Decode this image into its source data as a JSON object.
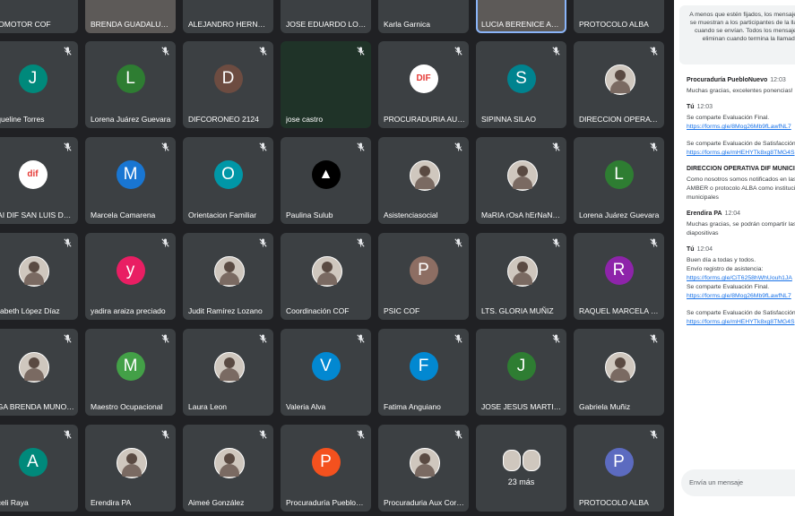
{
  "participants": [
    [
      {
        "name": "ROMOTOR COF",
        "letter": "",
        "color": "#1e88e5",
        "muted": false
      },
      {
        "name": "BRENDA GUADALUPE ...",
        "letter": "",
        "color": "#5d5a58",
        "muted": false,
        "photo": true
      },
      {
        "name": "ALEJANDRO HERNAND...",
        "letter": "",
        "color": "#e91e63",
        "muted": false
      },
      {
        "name": "JOSE EDUARDO LOPEZ...",
        "letter": "",
        "color": "#ff5722",
        "muted": false
      },
      {
        "name": "Karla Garnica",
        "letter": "",
        "color": "#3c4043",
        "muted": false
      },
      {
        "name": "LUCIA BERENICE ACOS...",
        "letter": "",
        "color": "#5d5a58",
        "muted": false,
        "photo": true,
        "highlight": true
      },
      {
        "name": "PROTOCOLO ALBA",
        "letter": "",
        "color": "#7b1fa2",
        "muted": false
      }
    ],
    [
      {
        "name": "cqueline Torres",
        "letter": "J",
        "color": "#00897b",
        "muted": true
      },
      {
        "name": "Lorena Juárez Guevara",
        "letter": "L",
        "color": "#2e7d32",
        "muted": true
      },
      {
        "name": "DIFCORONEO 2124",
        "letter": "D",
        "color": "#6d4c41",
        "muted": true
      },
      {
        "name": "jose castro",
        "letter": "",
        "color": "",
        "muted": true,
        "dark": true
      },
      {
        "name": "PROCURADURIA AUXIL...",
        "letter": "DIF",
        "color": "#fff",
        "muted": true,
        "logo": true
      },
      {
        "name": "SIPINNA SILAO",
        "letter": "S",
        "color": "#00838f",
        "muted": true
      },
      {
        "name": "DIRECCION OPERATIV...",
        "letter": "",
        "color": "",
        "muted": true,
        "img": true
      }
    ],
    [
      {
        "name": "PAI DIF SAN LUIS DE L...",
        "letter": "dif",
        "color": "#fff",
        "muted": true,
        "logo": true
      },
      {
        "name": "Marcela Camarena",
        "letter": "M",
        "color": "#1976d2",
        "muted": true
      },
      {
        "name": "Orientacion Familiar",
        "letter": "O",
        "color": "#0097a7",
        "muted": true
      },
      {
        "name": "Paulina Sulub",
        "letter": "▲",
        "color": "#000",
        "muted": true
      },
      {
        "name": "Asistenciasocial",
        "letter": "",
        "color": "",
        "muted": true,
        "img": true
      },
      {
        "name": "MaRIA rOsA hErNaNdE...",
        "letter": "",
        "color": "",
        "muted": true,
        "img": true
      },
      {
        "name": "Lorena Juárez Guevara",
        "letter": "L",
        "color": "#2e7d32",
        "muted": true
      }
    ],
    [
      {
        "name": "lizabeth López Díaz",
        "letter": "",
        "color": "",
        "muted": true,
        "img": true
      },
      {
        "name": "yadira araiza preciado",
        "letter": "y",
        "color": "#e91e63",
        "muted": true
      },
      {
        "name": "Judit Ramírez Lozano",
        "letter": "",
        "color": "",
        "muted": true,
        "img": true
      },
      {
        "name": "Coordinación COF",
        "letter": "",
        "color": "",
        "muted": true,
        "img": true
      },
      {
        "name": "PSIC COF",
        "letter": "P",
        "color": "#8d6e63",
        "muted": true
      },
      {
        "name": "LTS. GLORIA MUÑIZ",
        "letter": "",
        "color": "",
        "muted": true,
        "img": true
      },
      {
        "name": "RAQUEL MARCELA GU...",
        "letter": "R",
        "color": "#8e24aa",
        "muted": true
      }
    ],
    [
      {
        "name": "LGA BRENDA MUNOZ...",
        "letter": "",
        "color": "",
        "muted": true,
        "img": true
      },
      {
        "name": "Maestro Ocupacional",
        "letter": "M",
        "color": "#43a047",
        "muted": true
      },
      {
        "name": "Laura Leon",
        "letter": "",
        "color": "",
        "muted": true,
        "img": true
      },
      {
        "name": "Valeria Alva",
        "letter": "V",
        "color": "#0288d1",
        "muted": true
      },
      {
        "name": "Fatima Anguiano",
        "letter": "F",
        "color": "#0288d1",
        "muted": true
      },
      {
        "name": "JOSE JESUS MARTINEZ...",
        "letter": "J",
        "color": "#2e7d32",
        "muted": true
      },
      {
        "name": "Gabriela Muñiz",
        "letter": "",
        "color": "",
        "muted": true,
        "img": true
      }
    ],
    [
      {
        "name": "aceli Raya",
        "letter": "A",
        "color": "#00897b",
        "muted": true
      },
      {
        "name": "Erendira PA",
        "letter": "",
        "color": "",
        "muted": true,
        "img": true
      },
      {
        "name": "Aimeé González",
        "letter": "",
        "color": "",
        "muted": true,
        "img": true
      },
      {
        "name": "Procuraduría PuebloNu...",
        "letter": "P",
        "color": "#f4511e",
        "muted": true
      },
      {
        "name": "Procuraduria Aux Coro...",
        "letter": "",
        "color": "",
        "muted": true,
        "img": true
      },
      {
        "name": "",
        "letter": "",
        "color": "",
        "muted": false,
        "more": true
      },
      {
        "name": "PROTOCOLO ALBA",
        "letter": "P",
        "color": "#5c6bc0",
        "muted": true
      }
    ]
  ],
  "more_count": "23 más",
  "chat": {
    "notice": "A menos que estén fijados, los mensajes solo se muestran a los participantes de la llamada cuando se envían. Todos los mensajes se eliminan cuando termina la llamada.",
    "messages": [
      {
        "sender": "Procuraduría PuebloNuevo",
        "time": "12:03",
        "lines": [
          {
            "text": "Muchas gracias, excelentes ponencias!",
            "link": false
          }
        ]
      },
      {
        "sender": "Tú",
        "time": "12:03",
        "lines": [
          {
            "text": "Se comparte  Evaluación Final.",
            "link": false
          },
          {
            "text": "https://forms.gle/8Mog26Mb9fLawfNL7",
            "link": true
          }
        ]
      },
      {
        "sender": "",
        "time": "",
        "lines": [
          {
            "text": "Se comparte Evaluación de Satisfacción.",
            "link": false
          },
          {
            "text": "https://forms.gle/mHEHYTk8xg8TMG4S",
            "link": true
          }
        ]
      },
      {
        "sender": "DIRECCION OPERATIVA DIF MUNICIPAL",
        "time": "",
        "lines": [
          {
            "text": "Como nosotros somos notificados en las",
            "link": false
          },
          {
            "text": "AMBER o protocolo ALBA como institucio",
            "link": false
          },
          {
            "text": "municipales",
            "link": false
          }
        ]
      },
      {
        "sender": "Erendira PA",
        "time": "12:04",
        "lines": [
          {
            "text": "Muchas gracias, se podrán compartir las",
            "link": false
          },
          {
            "text": "diapositivas",
            "link": false
          }
        ]
      },
      {
        "sender": "Tú",
        "time": "12:04",
        "lines": [
          {
            "text": "Buen día a todas y todos.",
            "link": false
          },
          {
            "text": "Envío registro de asistencia:",
            "link": false
          },
          {
            "text": "https://forms.gle/CiT6258hWhUouh1JA",
            "link": true
          },
          {
            "text": "Se comparte  Evaluación Final.",
            "link": false
          },
          {
            "text": "https://forms.gle/8Mog26Mb9fLawfNL7",
            "link": true
          }
        ]
      },
      {
        "sender": "",
        "time": "",
        "lines": [
          {
            "text": "Se comparte Evaluación de Satisfacción.",
            "link": false
          },
          {
            "text": "https://forms.gle/mHEHYTk8xg8TMG4S",
            "link": true
          }
        ]
      }
    ],
    "input_placeholder": "Envía un mensaje"
  }
}
